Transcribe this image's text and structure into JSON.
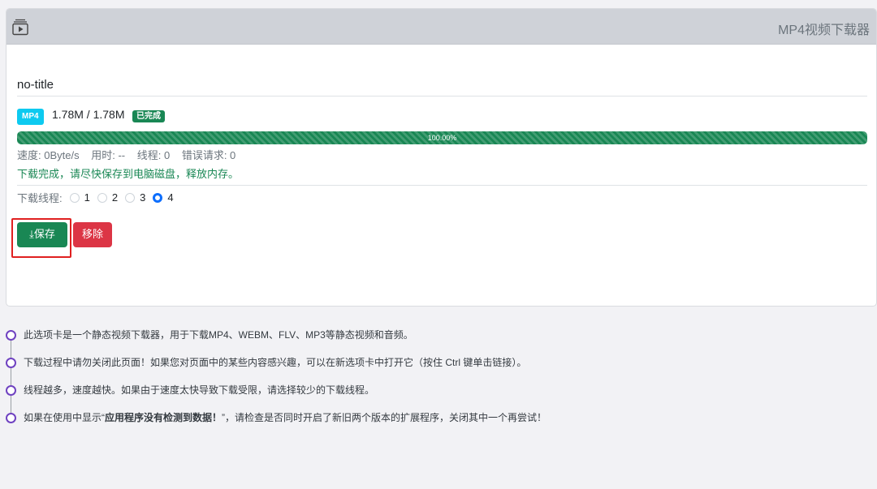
{
  "header": {
    "title": "MP4视频下载器",
    "icon": "video-player-icon"
  },
  "video": {
    "title": "no-title",
    "format": "MP4",
    "size": "1.78M / 1.78M",
    "status": "已完成",
    "progress_label": "100.00%",
    "progress": 1.0
  },
  "stats": {
    "speed": "速度: 0Byte/s",
    "elapsed": "用时: --",
    "threads": "线程: 0",
    "errors": "错误请求: 0"
  },
  "done_message": "下载完成，请尽快保存到电脑磁盘，释放内存。",
  "thread_select": {
    "label": "下载线程:",
    "options": [
      "1",
      "2",
      "3",
      "4"
    ],
    "selected": "4"
  },
  "buttons": {
    "save": "⤓保存",
    "remove": "移除"
  },
  "tips": {
    "tip1": "此选项卡是一个静态视频下载器，用于下载MP4、WEBM、FLV、MP3等静态视频和音频。",
    "tip2": "下载过程中请勿关闭此页面！如果您对页面中的某些内容感兴趣，可以在新选项卡中打开它（按住 Ctrl 键单击链接）。",
    "tip3": "线程越多，速度越快。如果由于速度太快导致下载受限，请选择较少的下载线程。",
    "tip4_prefix": "如果在使用中显示“",
    "tip4_bold": "应用程序没有检测到数据！",
    "tip4_suffix": "”，请检查是否同时开启了新旧两个版本的扩展程序，关闭其中一个再尝试！"
  },
  "colors": {
    "success": "#198754",
    "danger": "#dc3545",
    "info": "#0dcaf0",
    "primary": "#0d6efd",
    "timeline": "#6f42c1"
  }
}
